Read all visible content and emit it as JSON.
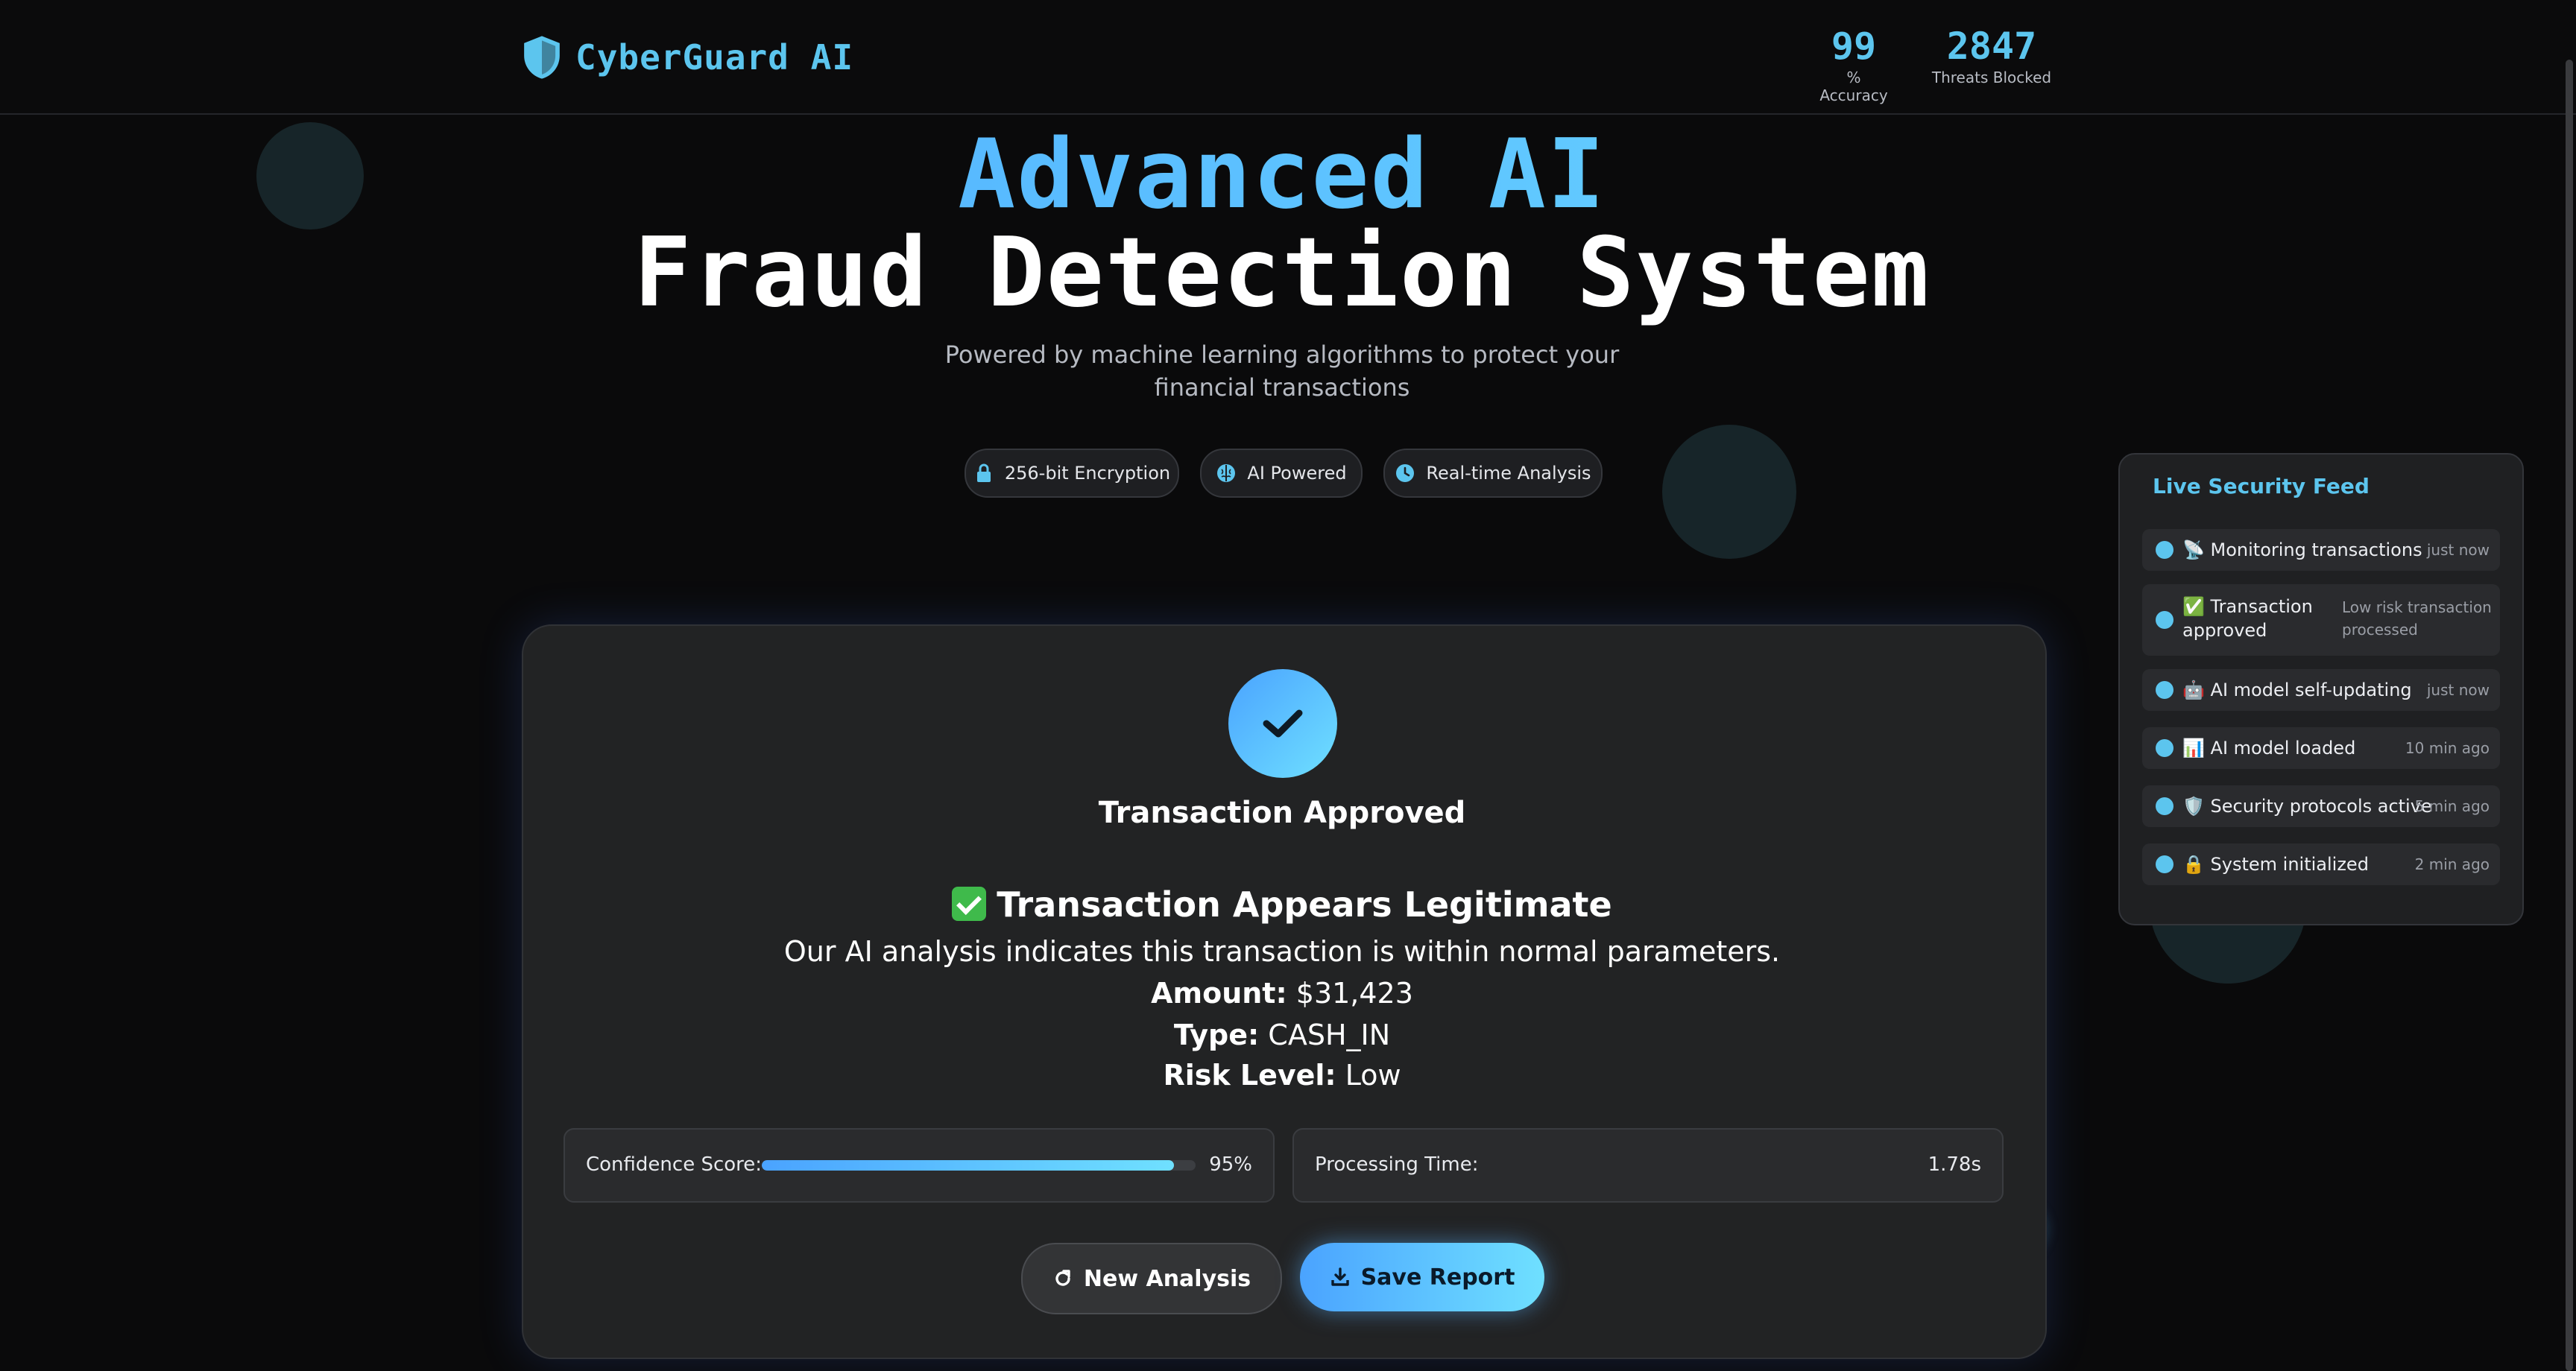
{
  "header": {
    "brand": "CyberGuard AI",
    "stats": [
      {
        "value": "99",
        "label": "% Accuracy"
      },
      {
        "value": "2847",
        "label": "Threats Blocked"
      }
    ]
  },
  "hero": {
    "title_line1": "Advanced AI",
    "title_line2": "Fraud Detection System",
    "subtitle": "Powered by machine learning algorithms to protect your financial transactions",
    "badges": [
      {
        "label": "256-bit Encryption",
        "icon": "lock-icon"
      },
      {
        "label": "AI Powered",
        "icon": "brain-icon"
      },
      {
        "label": "Real-time Analysis",
        "icon": "clock-icon"
      }
    ]
  },
  "result": {
    "status": "Transaction Approved",
    "headline": "Transaction Appears Legitimate",
    "description": "Our AI analysis indicates this transaction is within normal parameters.",
    "amount_label": "Amount:",
    "amount_value": "$31,423",
    "type_label": "Type:",
    "type_value": "CASH_IN",
    "risk_label": "Risk Level:",
    "risk_value": "Low",
    "confidence_label": "Confidence Score:",
    "confidence_value": "95%",
    "confidence_fraction": 0.95,
    "processing_label": "Processing Time:",
    "processing_value": "1.78s",
    "buttons": {
      "new_analysis": "New Analysis",
      "save_report": "Save Report"
    }
  },
  "feed": {
    "title": "Live Security Feed",
    "items": [
      {
        "emoji": "satellite",
        "text": "Monitoring transactions",
        "time": "just now"
      },
      {
        "emoji": "check",
        "text": "Transaction approved",
        "time": "Low risk transaction processed"
      },
      {
        "emoji": "robot",
        "text": "AI model self-updating",
        "time": "just now"
      },
      {
        "emoji": "chart",
        "text": "AI model loaded",
        "time": "10 min ago"
      },
      {
        "emoji": "shield",
        "text": "Security protocols active",
        "time": "5 min ago"
      },
      {
        "emoji": "lock",
        "text": "System initialized",
        "time": "2 min ago"
      }
    ]
  },
  "colors": {
    "accent": "#5cc5ee",
    "gradient_start": "#4aa3ff",
    "gradient_end": "#6fe0ff",
    "background": "#0a0a0b",
    "card": "#222324"
  }
}
